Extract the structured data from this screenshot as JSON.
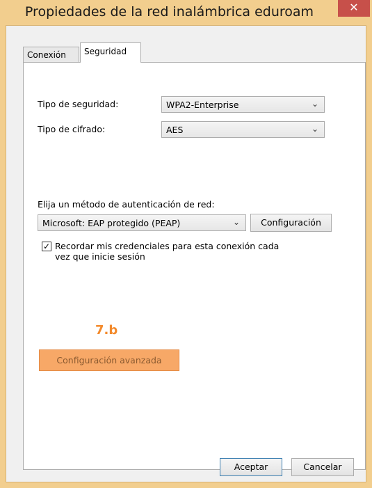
{
  "window": {
    "title": "Propiedades de la red inalámbrica eduroam",
    "close_label": "✕"
  },
  "tabs": [
    {
      "label": "Conexión",
      "active": false
    },
    {
      "label": "Seguridad",
      "active": true
    }
  ],
  "security": {
    "type_label": "Tipo de seguridad:",
    "type_value": "WPA2-Enterprise",
    "cipher_label": "Tipo de cifrado:",
    "cipher_value": "AES"
  },
  "auth": {
    "method_label": "Elija un método de autenticación de red:",
    "method_value": "Microsoft: EAP protegido (PEAP)",
    "config_button": "Configuración",
    "remember_label_line1": "Recordar mis credenciales para esta conexión cada",
    "remember_label_line2": "vez que inicie sesión",
    "remember_checked": true
  },
  "annotation": {
    "step": "7.b",
    "color": "#f38a2c"
  },
  "advanced_button": "Configuración avanzada",
  "footer": {
    "ok_label": "Aceptar",
    "cancel_label": "Cancelar"
  },
  "colors": {
    "title_bar": "#f2ce8e",
    "close": "#c7504a",
    "highlight": "#f7a867"
  }
}
